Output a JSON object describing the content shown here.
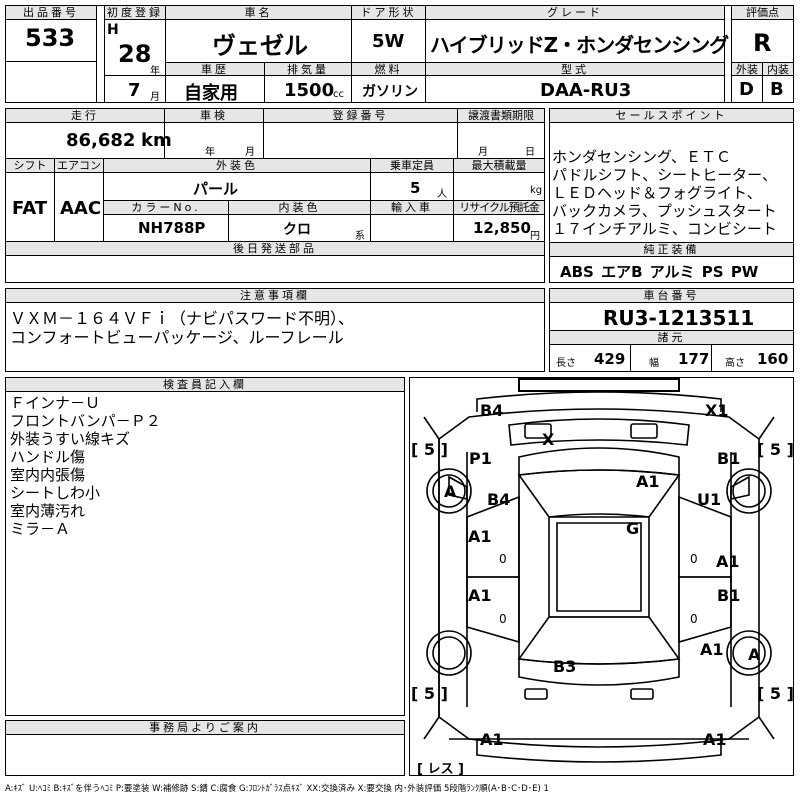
{
  "header": {
    "lot_label": "出品番号",
    "lot": "533",
    "reg_label": "初度登録",
    "era": "H",
    "year": "28",
    "year_unit": "年",
    "month": "7",
    "month_unit": "月",
    "car_label": "車名",
    "car": "ヴェゼル",
    "door_label": "ドア形状",
    "door": "5W",
    "grade_label": "グレード",
    "grade": "ハイブリッドZ・ホンダセンシング",
    "score_label": "評価点",
    "score": "R",
    "history_label": "車歴",
    "history": "自家用",
    "disp_label": "排気量",
    "disp": "1500",
    "disp_unit": "cc",
    "fuel_label": "燃料",
    "fuel": "ガソリン",
    "model_label": "型式",
    "model": "DAA-RU3",
    "ext_label": "外装",
    "ext": "D",
    "int_label": "内装",
    "int": "B"
  },
  "row2": {
    "km_label": "走行",
    "km": "86,682",
    "km_unit": "km",
    "shaken_label": "車検",
    "shaken_y": "年",
    "shaken_m": "月",
    "plate_label": "登録番号",
    "transfer_label": "譲渡書類期限",
    "transfer_m": "月",
    "transfer_d": "日",
    "shift_label": "シフト",
    "shift": "FAT",
    "ac_label": "エアコン",
    "ac": "AAC",
    "color_label": "外装色",
    "color": "パール",
    "cap_label": "乗車定員",
    "cap": "5",
    "cap_unit": "人",
    "load_label": "最大積載量",
    "load_unit": "kg",
    "colorno_label": "カラーNo.",
    "colorno": "NH788P",
    "intcolor_label": "内装色",
    "intcolor": "クロ",
    "intcolor_unit": "系",
    "import_label": "輸入車",
    "recycle_label": "リサイクル預託金",
    "recycle": "12,850",
    "recycle_unit": "円",
    "later_label": "後日発送部品"
  },
  "sales": {
    "label": "セールスポイント",
    "lines": [
      "ホンダセンシング、ＥＴＣ",
      "パドルシフト、シートヒーター、",
      "ＬＥＤヘッド＆フォグライト、",
      "バックカメラ、プッシュスタート",
      "１７インチアルミ、コンビシート"
    ],
    "equip_label": "純正装備",
    "equip": "ABS エアB アルミ PS PW"
  },
  "notes": {
    "label": "注意事項欄",
    "lines": [
      "ＶＸＭ－１６４ＶＦｉ（ナビパスワード不明）、",
      "コンフォートビューパッケージ、ルーフレール"
    ]
  },
  "chassis": {
    "label": "車台番号",
    "value": "RU3-1213511",
    "dims_label": "諸元",
    "len_label": "長さ",
    "len": "429",
    "wid_label": "幅",
    "wid": "177",
    "hei_label": "高さ",
    "hei": "160"
  },
  "inspector": {
    "label": "検査員記入欄",
    "lines": [
      "Ｆインナ－Ｕ",
      "フロントバンパ－Ｐ２",
      "外装うすい線キズ",
      "ハンドル傷",
      "室内内張傷",
      "シートしわ小",
      "室内薄汚れ",
      "ミラ－Ａ"
    ]
  },
  "office": {
    "label": "事務局よりご案内"
  },
  "diagram": {
    "marks": {
      "b4_top": "B4",
      "x1_top": "X1",
      "x_glass": "X",
      "p1": "P1",
      "a_wheel_fl": "A",
      "b4_hood": "B4",
      "a1_hood": "A1",
      "b1_r": "B1",
      "u1": "U1",
      "g_roof": "G",
      "a1_fd": "A1",
      "a1_rd": "A1",
      "b1_rr": "B1",
      "a1_rf": "A1",
      "a1_rq": "A1",
      "a_wheel_rr": "A",
      "b3_trunk": "B3",
      "a1_bl": "A1",
      "a1_br": "A1",
      "zero1": "0",
      "zero2": "0",
      "zero3": "0",
      "zero4": "0"
    },
    "tire_tl": "[ 5 ]",
    "tire_tr": "[ 5 ]",
    "tire_bl": "[ 5 ]",
    "tire_br": "[ 5 ]",
    "spare": "[ レス ]"
  },
  "legend": "A:ｷｽﾞ U:ﾍｺﾐ B:ｷｽﾞを伴うﾍｺﾐ P:要塗装 W:補修跡 S:錆 C:腐食 G:ﾌﾛﾝﾄｶﾞﾗｽ点ｷｽﾞ XX:交換済み X:要交換 内･外装評価 5段階ﾗﾝｸ順(A･B･C･D･E) 1"
}
